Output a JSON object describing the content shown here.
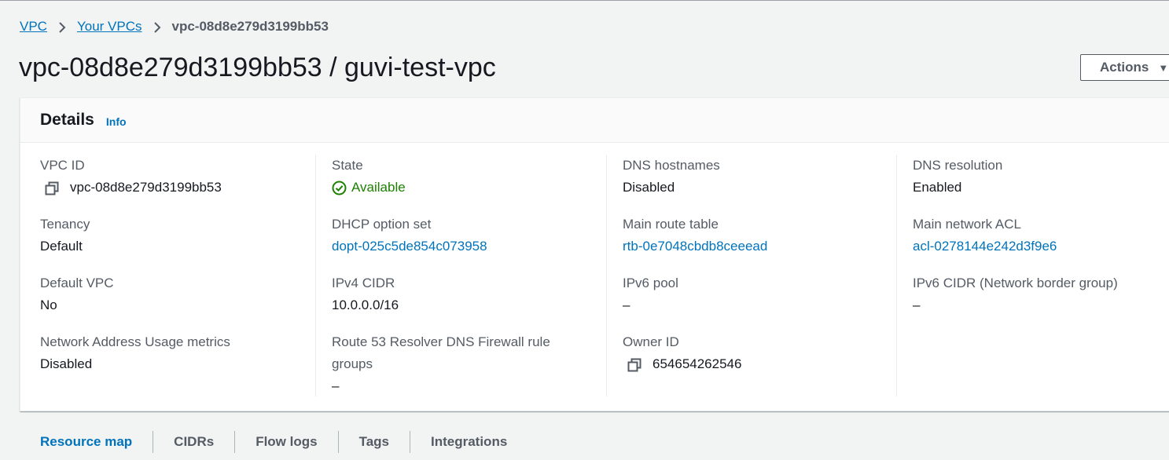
{
  "breadcrumb": {
    "items": [
      {
        "label": "VPC"
      },
      {
        "label": "Your VPCs"
      },
      {
        "label": "vpc-08d8e279d3199bb53"
      }
    ]
  },
  "header": {
    "title": "vpc-08d8e279d3199bb53 / guvi-test-vpc",
    "actions_label": "Actions"
  },
  "details": {
    "title": "Details",
    "info_label": "Info",
    "columns": [
      [
        {
          "label": "VPC ID",
          "value": "vpc-08d8e279d3199bb53",
          "icon": "copy-icon"
        },
        {
          "label": "Tenancy",
          "value": "Default"
        },
        {
          "label": "Default VPC",
          "value": "No"
        },
        {
          "label": "Network Address Usage metrics",
          "value": "Disabled"
        }
      ],
      [
        {
          "label": "State",
          "value": "Available",
          "icon": "check-circle-icon"
        },
        {
          "label": "DHCP option set",
          "value": "dopt-025c5de854c073958"
        },
        {
          "label": "IPv4 CIDR",
          "value": "10.0.0.0/16"
        },
        {
          "label": "Route 53 Resolver DNS Firewall rule groups",
          "value": "–"
        }
      ],
      [
        {
          "label": "DNS hostnames",
          "value": "Disabled"
        },
        {
          "label": "Main route table",
          "value": "rtb-0e7048cbdb8ceeead"
        },
        {
          "label": "IPv6 pool",
          "value": "–"
        },
        {
          "label": "Owner ID",
          "value": "654654262546",
          "icon": "copy-icon"
        }
      ],
      [
        {
          "label": "DNS resolution",
          "value": "Enabled"
        },
        {
          "label": "Main network ACL",
          "value": "acl-0278144e242d3f9e6"
        },
        {
          "label": "IPv6 CIDR (Network border group)",
          "value": "–"
        }
      ]
    ]
  },
  "tabs": [
    {
      "label": "Resource map"
    },
    {
      "label": "CIDRs"
    },
    {
      "label": "Flow logs"
    },
    {
      "label": "Tags"
    },
    {
      "label": "Integrations"
    }
  ],
  "colors": {
    "link": "#0073bb",
    "success": "#1d8102",
    "text": "#16191f",
    "label": "#545b64",
    "background": "#f2f3f3"
  }
}
